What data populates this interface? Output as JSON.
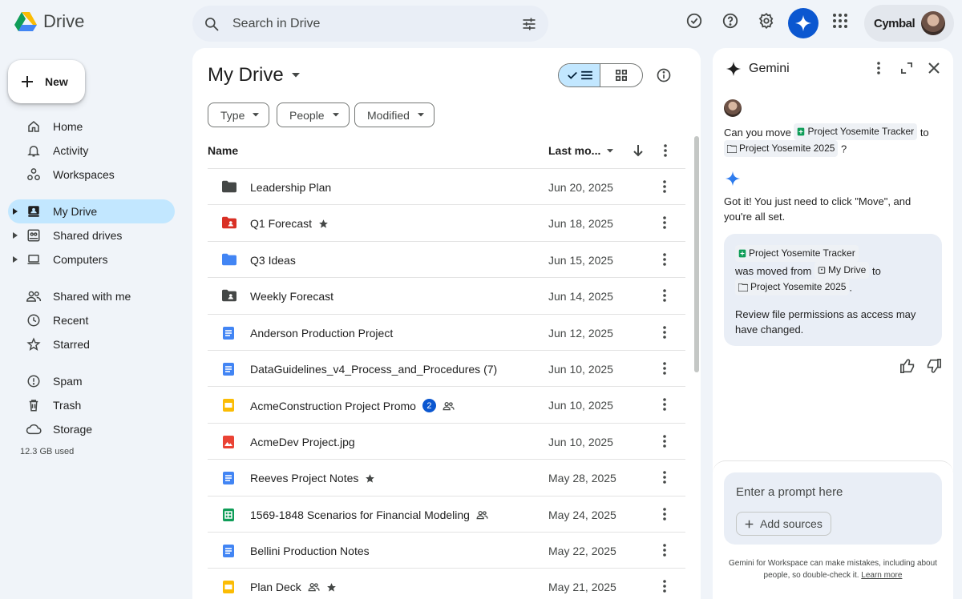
{
  "app": {
    "name": "Drive"
  },
  "search": {
    "placeholder": "Search in Drive"
  },
  "account": {
    "brand": "Cymbal"
  },
  "sidebar": {
    "new_label": "New",
    "items": [
      {
        "label": "Home",
        "icon": "home-icon"
      },
      {
        "label": "Activity",
        "icon": "bell-icon"
      },
      {
        "label": "Workspaces",
        "icon": "workspaces-icon"
      },
      {
        "label": "My Drive",
        "icon": "my-drive-icon",
        "active": true
      },
      {
        "label": "Shared drives",
        "icon": "shared-drives-icon"
      },
      {
        "label": "Computers",
        "icon": "computer-icon"
      },
      {
        "label": "Shared with me",
        "icon": "people-icon"
      },
      {
        "label": "Recent",
        "icon": "clock-icon"
      },
      {
        "label": "Starred",
        "icon": "star-icon"
      },
      {
        "label": "Spam",
        "icon": "spam-icon"
      },
      {
        "label": "Trash",
        "icon": "trash-icon"
      },
      {
        "label": "Storage",
        "icon": "cloud-icon"
      }
    ],
    "storage_used": "12.3 GB used"
  },
  "main": {
    "title": "My Drive",
    "filters": [
      "Type",
      "People",
      "Modified"
    ],
    "columns": {
      "name": "Name",
      "modified": "Last mo..."
    },
    "rows": [
      {
        "name": "Leadership Plan",
        "date": "Jun 20, 2025",
        "icon": "folder-dark-icon"
      },
      {
        "name": "Q1 Forecast",
        "date": "Jun 18, 2025",
        "icon": "folder-red-shared-icon",
        "starred": true
      },
      {
        "name": "Q3 Ideas",
        "date": "Jun 15, 2025",
        "icon": "folder-blue-icon"
      },
      {
        "name": "Weekly Forecast",
        "date": "Jun 14, 2025",
        "icon": "folder-shared-icon"
      },
      {
        "name": "Anderson Production Project",
        "date": "Jun 12, 2025",
        "icon": "docs-icon"
      },
      {
        "name": "DataGuidelines_v4_Process_and_Procedures (7)",
        "date": "Jun 10, 2025",
        "icon": "docs-icon"
      },
      {
        "name": "AcmeConstruction Project Promo",
        "date": "Jun 10, 2025",
        "icon": "slides-icon",
        "badge": "2",
        "shared": true
      },
      {
        "name": "AcmeDev Project.jpg",
        "date": "Jun 10, 2025",
        "icon": "image-icon"
      },
      {
        "name": "Reeves Project Notes",
        "date": "May 28, 2025",
        "icon": "docs-icon",
        "starred": true
      },
      {
        "name": "1569-1848 Scenarios for Financial Modeling",
        "date": "May 24, 2025",
        "icon": "sheets-icon",
        "shared": true
      },
      {
        "name": "Bellini Production Notes",
        "date": "May 22, 2025",
        "icon": "docs-icon"
      },
      {
        "name": "Plan Deck",
        "date": "May 21, 2025",
        "icon": "slides-icon",
        "shared": true,
        "starred": true
      }
    ]
  },
  "gemini": {
    "title": "Gemini",
    "user_msg": {
      "p1": "Can you move",
      "file": "Project Yosemite Tracker",
      "p2": "to",
      "folder": "Project Yosemite 2025",
      "p3": "?"
    },
    "reply": "Got it! You just need to click \"Move\", and you're all set.",
    "card": {
      "file": "Project Yosemite Tracker",
      "moved_from": "was moved from",
      "from_folder": "My Drive",
      "to": "to",
      "to_folder": "Project Yosemite 2025",
      "period": ".",
      "note": "Review file permissions as access may have changed."
    },
    "prompt_placeholder": "Enter a prompt here",
    "add_sources": "Add sources",
    "disclaimer": "Gemini for Workspace can make mistakes, including about people, so double-check it.",
    "learn_more": "Learn more"
  }
}
